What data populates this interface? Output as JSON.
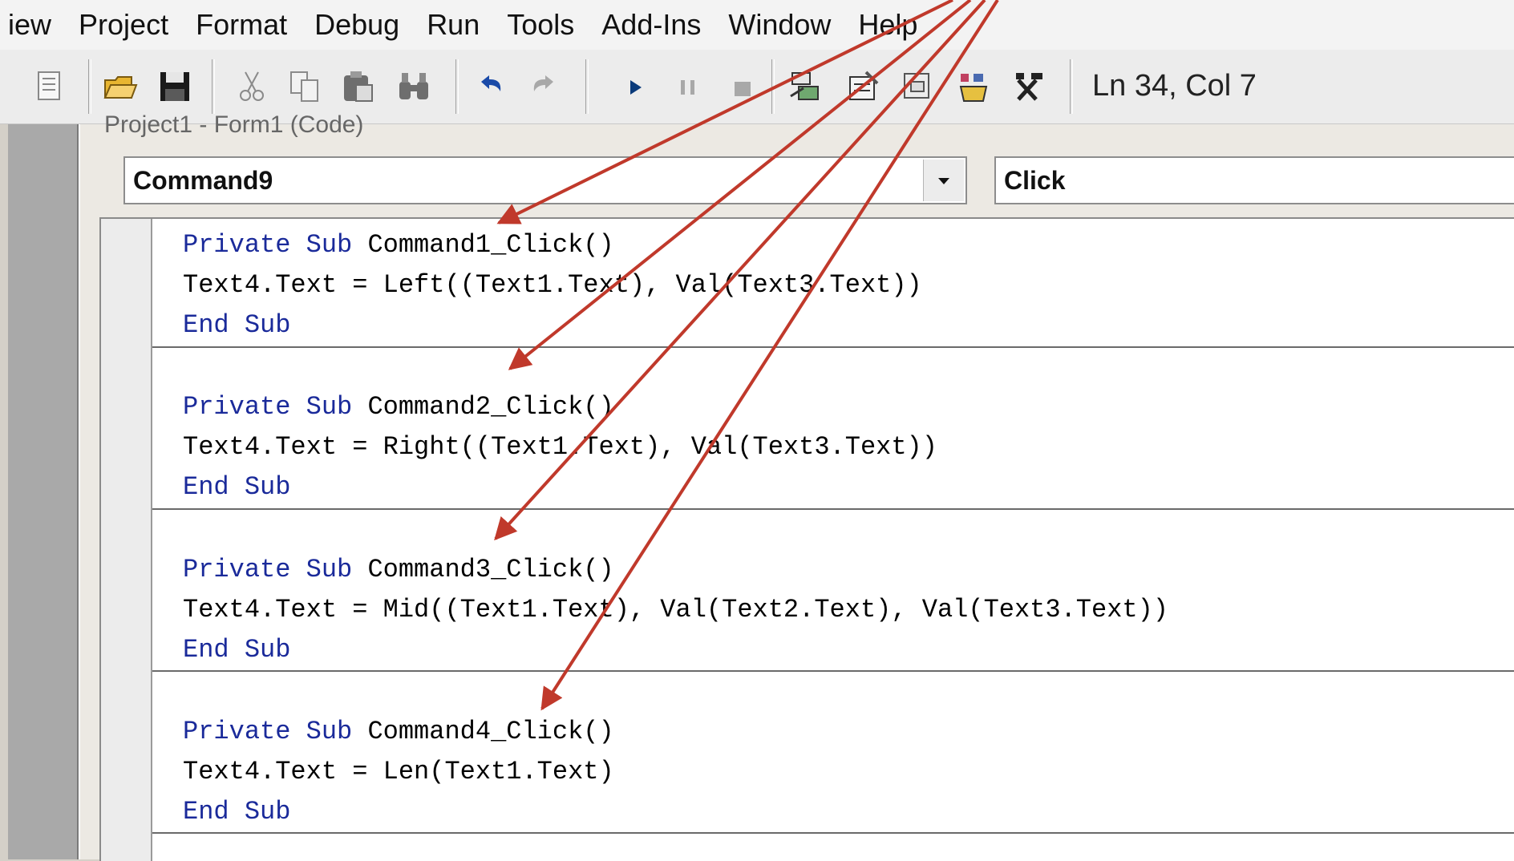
{
  "menu": [
    "iew",
    "Project",
    "Format",
    "Debug",
    "Run",
    "Tools",
    "Add-Ins",
    "Window",
    "Help"
  ],
  "toolbar": {
    "status": "Ln 34, Col 7",
    "icons": [
      "view-object-icon",
      "open-icon",
      "save-icon",
      "cut-icon",
      "copy-icon",
      "paste-icon",
      "find-icon",
      "undo-icon",
      "redo-icon",
      "run-icon",
      "pause-icon",
      "stop-icon",
      "project-explorer-icon",
      "properties-icon",
      "form-layout-icon",
      "object-browser-icon",
      "toolbox-icon"
    ]
  },
  "window": {
    "title": "Project1 - Form1 (Code)"
  },
  "object_combo": {
    "value": "Command9"
  },
  "proc_combo": {
    "value": "Click"
  },
  "code": {
    "procs": [
      {
        "sig_kw": "Private Sub",
        "sig_name": "Command1_Click()",
        "body": "Text4.Text = Left((Text1.Text), Val(Text3.Text))",
        "end_kw": "End Sub"
      },
      {
        "sig_kw": "Private Sub",
        "sig_name": "Command2_Click()",
        "body": "Text4.Text = Right((Text1.Text), Val(Text3.Text))",
        "end_kw": "End Sub"
      },
      {
        "sig_kw": "Private Sub",
        "sig_name": "Command3_Click()",
        "body": "Text4.Text = Mid((Text1.Text), Val(Text2.Text), Val(Text3.Text))",
        "end_kw": "End Sub"
      },
      {
        "sig_kw": "Private Sub",
        "sig_name": "Command4_Click()",
        "body": "Text4.Text = Len(Text1.Text)",
        "end_kw": "End Sub"
      }
    ]
  },
  "colors": {
    "keyword": "#1a2a9a",
    "arrow": "#c0392b"
  }
}
